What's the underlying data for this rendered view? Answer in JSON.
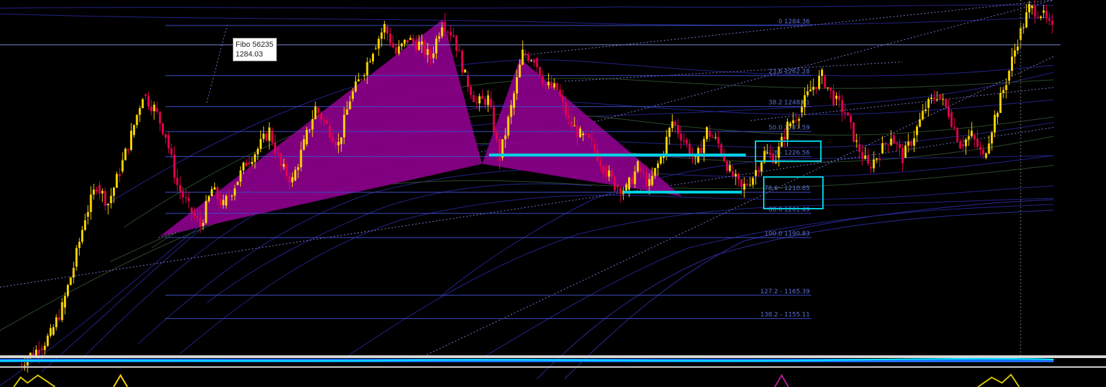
{
  "tooltip": {
    "title": "Fibo 56235",
    "value": "1284.03"
  },
  "colors": {
    "background": "#000000",
    "fib_line": "#3d4ec8",
    "fib_text": "#5b72d6",
    "candle_up": "#ffd700",
    "candle_down": "#e6004c",
    "harmonic_fill": "#8b008b",
    "zone": "#00d0e0",
    "ma_blue": "#23238a",
    "ma_green": "#2d4a2d"
  },
  "chart_data": {
    "type": "candlestick",
    "ylim": [
      1135,
      1300
    ],
    "grid": false,
    "fibonacci_levels": [
      {
        "ratio": 0,
        "price": 1284.36,
        "label": "0 1284.36"
      },
      {
        "ratio": 23.6,
        "price": 1262.28,
        "label": "23.6 1262.28"
      },
      {
        "ratio": 38.2,
        "price": 1248.61,
        "label": "38.2 1248.61"
      },
      {
        "ratio": 50.0,
        "price": 1237.59,
        "label": "50.0 1237.59"
      },
      {
        "ratio": 61.8,
        "price": 1226.56,
        "label": "61.8 - 1226.56"
      },
      {
        "ratio": 78.6,
        "price": 1210.85,
        "label": "78.6 - 1210.85"
      },
      {
        "ratio": 88.6,
        "price": 1201.49,
        "label": "88.6 1201.49"
      },
      {
        "ratio": 100.0,
        "price": 1190.83,
        "label": "100.0 1190.83"
      },
      {
        "ratio": 127.2,
        "price": 1165.39,
        "label": "127.2 - 1165.39"
      },
      {
        "ratio": 138.2,
        "price": 1155.11,
        "label": "138.2 - 1155.11"
      }
    ],
    "current_price_line": 1284.03,
    "closes": [
      1138,
      1142,
      1148,
      1160,
      1178,
      1200,
      1214,
      1206,
      1220,
      1236,
      1254,
      1248,
      1236,
      1214,
      1204,
      1196,
      1212,
      1205,
      1214,
      1224,
      1230,
      1238,
      1222,
      1216,
      1232,
      1248,
      1240,
      1232,
      1252,
      1262,
      1274,
      1284,
      1272,
      1278,
      1276,
      1270,
      1286,
      1280,
      1262,
      1250,
      1252,
      1226,
      1248,
      1272,
      1270,
      1258,
      1256,
      1242,
      1236,
      1232,
      1222,
      1214,
      1212,
      1222,
      1214,
      1226,
      1242,
      1234,
      1224,
      1238,
      1232,
      1220,
      1212,
      1218,
      1228,
      1226,
      1240,
      1246,
      1256,
      1262,
      1252,
      1246,
      1232,
      1222,
      1228,
      1236,
      1226,
      1236,
      1248,
      1254,
      1246,
      1232,
      1236,
      1226,
      1244,
      1260,
      1278,
      1292,
      1290,
      1282
    ]
  }
}
